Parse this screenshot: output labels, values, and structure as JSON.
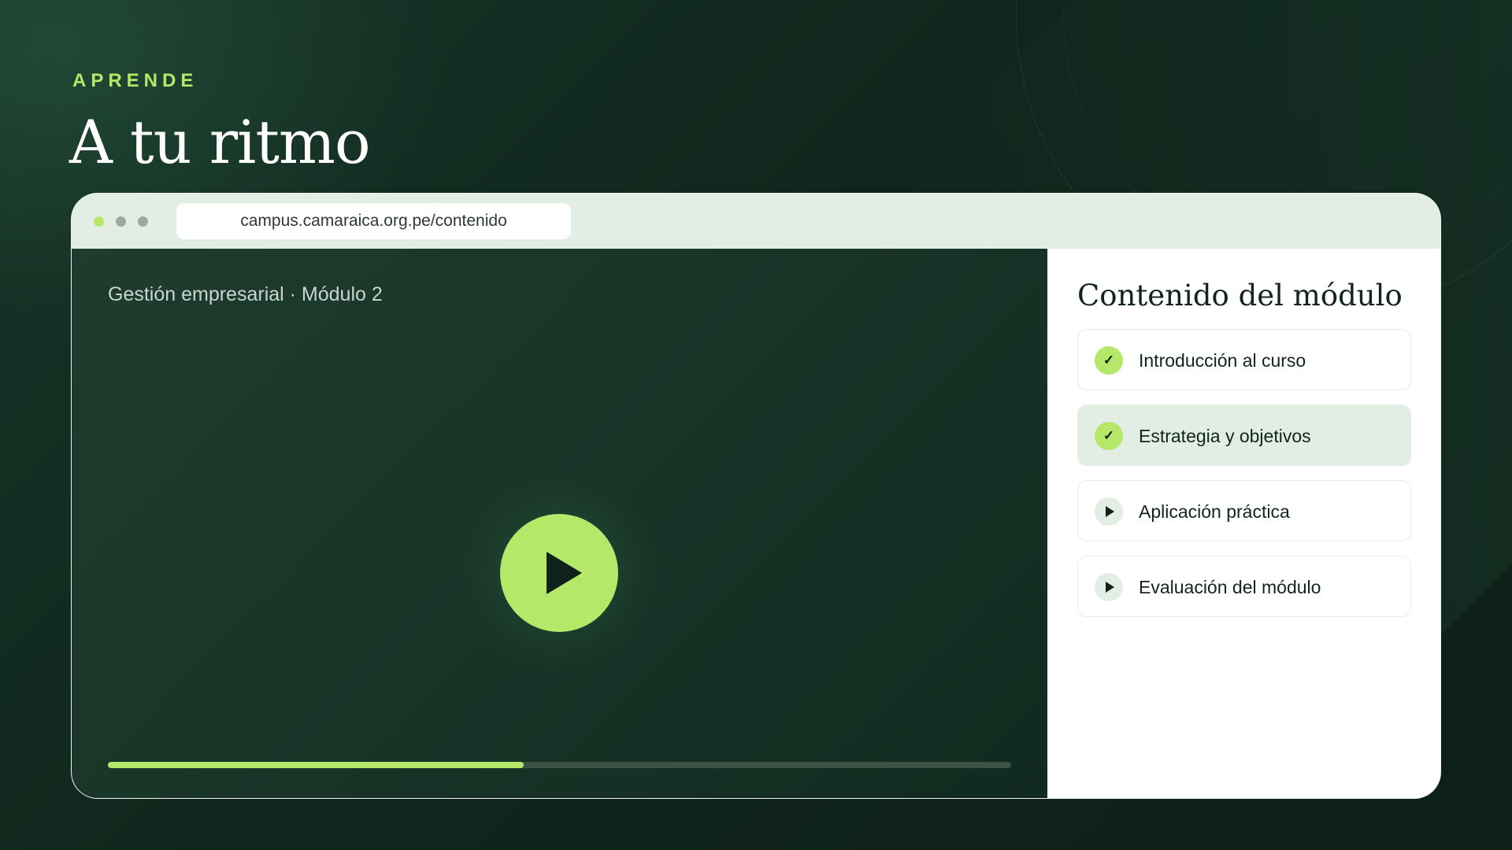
{
  "hero": {
    "eyebrow": "APRENDE",
    "title": "A tu ritmo"
  },
  "browser": {
    "url": "campus.camaraica.org.pe/contenido"
  },
  "player": {
    "course_label": "Gestión empresarial · Módulo 2",
    "play_icon": "play-icon",
    "progress_fraction": 0.46
  },
  "sidebar": {
    "title": "Contenido del módulo",
    "lessons": [
      {
        "label": "Introducción al curso",
        "status": "completed",
        "icon": "check-icon"
      },
      {
        "label": "Estrategia y objetivos",
        "status": "completed",
        "icon": "check-icon",
        "active": true
      },
      {
        "label": "Aplicación práctica",
        "status": "pending",
        "icon": "play-icon"
      },
      {
        "label": "Evaluación del módulo",
        "status": "pending",
        "icon": "play-icon"
      }
    ]
  },
  "colors": {
    "accent": "#b5e768",
    "background": "#0f2219",
    "chrome": "#e2ede4"
  }
}
